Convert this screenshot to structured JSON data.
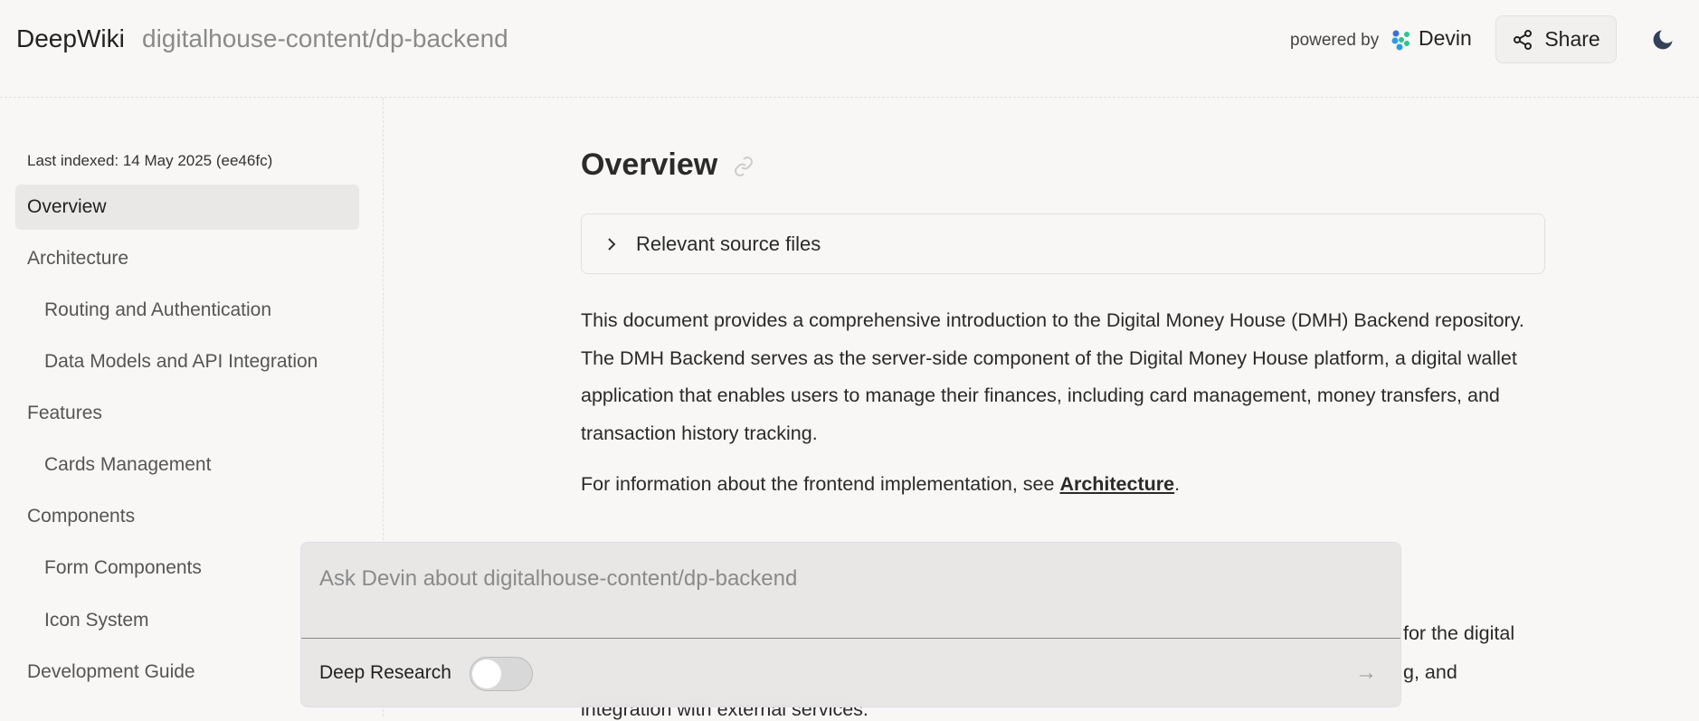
{
  "header": {
    "brand": "DeepWiki",
    "repo": "digitalhouse-content/dp-backend",
    "powered_by": "powered by",
    "devin": "Devin",
    "share": "Share"
  },
  "sidebar": {
    "last_indexed": "Last indexed: 14 May 2025 (ee46fc)",
    "items": [
      {
        "label": "Overview",
        "level": 0,
        "active": true
      },
      {
        "label": "Architecture",
        "level": 0
      },
      {
        "label": "Routing and Authentication",
        "level": 1
      },
      {
        "label": "Data Models and API Integration",
        "level": 1
      },
      {
        "label": "Features",
        "level": 0
      },
      {
        "label": "Cards Management",
        "level": 1
      },
      {
        "label": "Components",
        "level": 0
      },
      {
        "label": "Form Components",
        "level": 1
      },
      {
        "label": "Icon System",
        "level": 1
      },
      {
        "label": "Development Guide",
        "level": 0
      }
    ]
  },
  "main": {
    "title": "Overview",
    "sources": "Relevant source files",
    "p1": "This document provides a comprehensive introduction to the Digital Money House (DMH) Backend repository. The DMH Backend serves as the server-side component of the Digital Money House platform, a digital wallet application that enables users to manage their finances, including card management, money transfers, and transaction history tracking.",
    "p2_before": "For information about the frontend implementation, see ",
    "p2_link": "Architecture",
    "p2_after": ".",
    "frag1": "for the digital",
    "frag2": "g, and",
    "frag3": "integration with external services."
  },
  "chat": {
    "placeholder": "Ask Devin about digitalhouse-content/dp-backend",
    "deep_research": "Deep Research",
    "deep_research_on": false
  }
}
